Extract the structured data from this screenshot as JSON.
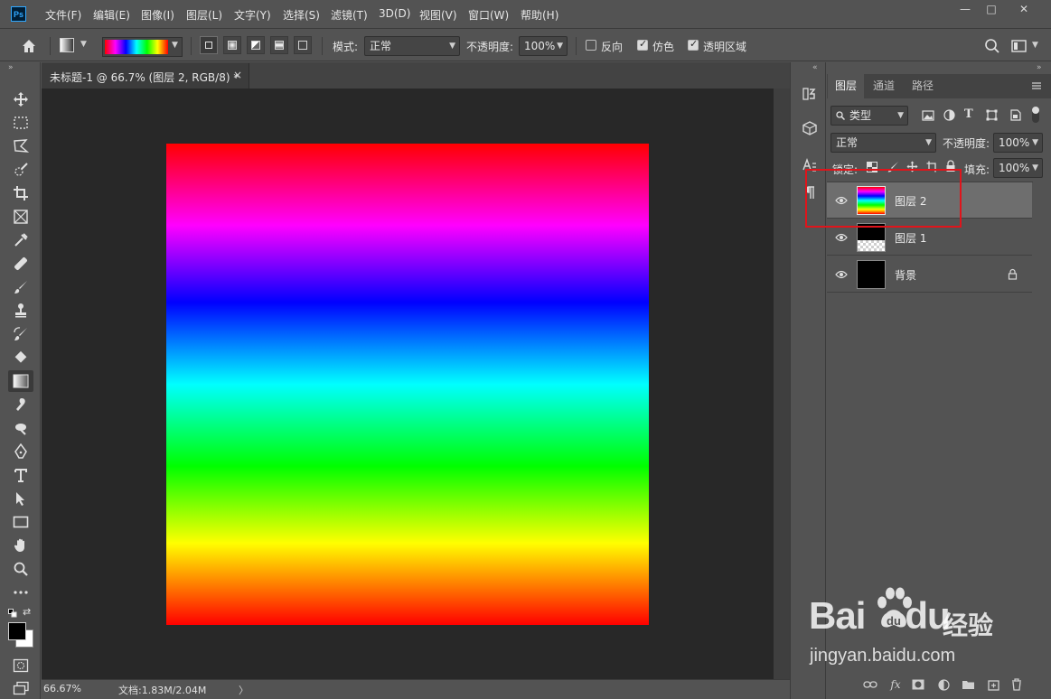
{
  "app": {
    "logo": "Ps"
  },
  "menu": [
    "文件(F)",
    "编辑(E)",
    "图像(I)",
    "图层(L)",
    "文字(Y)",
    "选择(S)",
    "滤镜(T)",
    "3D(D)",
    "视图(V)",
    "窗口(W)",
    "帮助(H)"
  ],
  "window_controls": {
    "minimize": "—",
    "maximize": "□",
    "close": "✕"
  },
  "options": {
    "mode_label": "模式:",
    "mode_value": "正常",
    "opacity_label": "不透明度:",
    "opacity_value": "100%",
    "reverse_label": "反向",
    "dither_label": "仿色",
    "transparency_label": "透明区域",
    "reverse_checked": false,
    "dither_checked": true,
    "transparency_checked": true
  },
  "document": {
    "tab_title": "未标题-1 @ 66.7% (图层 2, RGB/8) *",
    "close_glyph": "×",
    "gradient_colors": [
      "#ff0000",
      "#ff00ff",
      "#0000ff",
      "#00ffff",
      "#00ff00",
      "#ffff00",
      "#ff0000"
    ]
  },
  "status": {
    "zoom": "66.67%",
    "doc_info": "文档:1.83M/2.04M",
    "arrow": "〉"
  },
  "layers_panel": {
    "tabs": [
      "图层",
      "通道",
      "路径"
    ],
    "filter_label": "类型",
    "blend_mode": "正常",
    "opacity_label": "不透明度:",
    "opacity_value": "100%",
    "lock_label": "锁定:",
    "fill_label": "填充:",
    "fill_value": "100%",
    "layers": [
      {
        "name": "图层 2",
        "selected": true,
        "thumb": "rainbow"
      },
      {
        "name": "图层 1",
        "selected": false,
        "thumb": "checker"
      },
      {
        "name": "背景",
        "selected": false,
        "thumb": "black",
        "locked": true
      }
    ]
  },
  "watermark": {
    "brand": "Bai",
    "brand_tail": "du",
    "sub": "经验",
    "url": "jingyan.baidu.com"
  },
  "colors": {
    "ui_bg": "#535353",
    "canvas_bg": "#282828",
    "highlight": "#e0141b",
    "accent": "#31a8ff"
  }
}
